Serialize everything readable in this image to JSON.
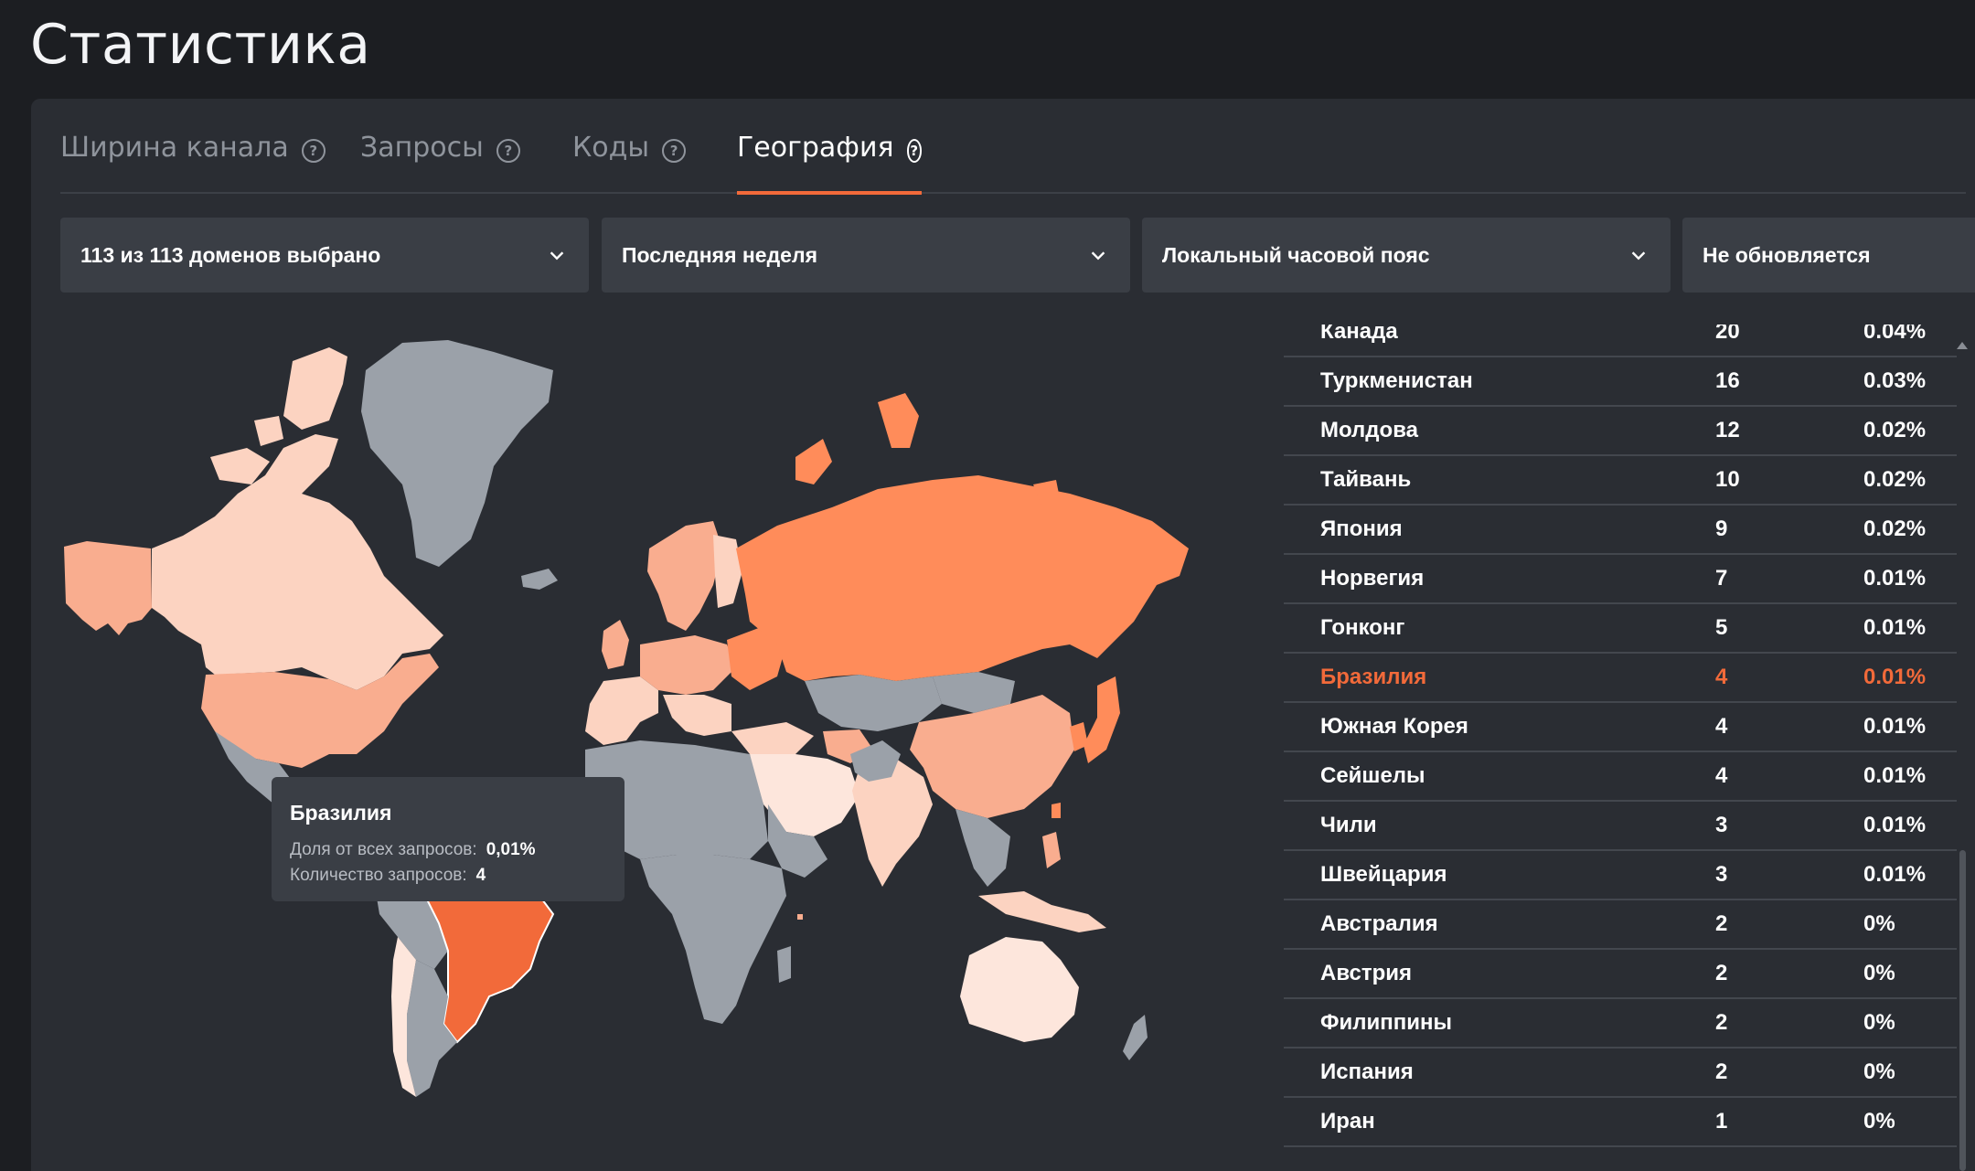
{
  "page_title": "Статистика",
  "tabs": [
    {
      "label": "Ширина канала",
      "active": false
    },
    {
      "label": "Запросы",
      "active": false
    },
    {
      "label": "Коды",
      "active": false
    },
    {
      "label": "География",
      "active": true
    }
  ],
  "filters": {
    "domains": "113 из 113 доменов выбрано",
    "period": "Последняя неделя",
    "timezone": "Локальный часовой пояс",
    "refresh": "Не обновляется"
  },
  "tooltip": {
    "country": "Бразилия",
    "share_label": "Доля от всех запросов:",
    "share_value": "0,01%",
    "count_label": "Количество запросов:",
    "count_value": "4"
  },
  "table": [
    {
      "country": "Канада",
      "count": "20",
      "percent": "0.04%"
    },
    {
      "country": "Туркменистан",
      "count": "16",
      "percent": "0.03%"
    },
    {
      "country": "Молдова",
      "count": "12",
      "percent": "0.02%"
    },
    {
      "country": "Тайвань",
      "count": "10",
      "percent": "0.02%"
    },
    {
      "country": "Япония",
      "count": "9",
      "percent": "0.02%"
    },
    {
      "country": "Норвегия",
      "count": "7",
      "percent": "0.01%"
    },
    {
      "country": "Гонконг",
      "count": "5",
      "percent": "0.01%"
    },
    {
      "country": "Бразилия",
      "count": "4",
      "percent": "0.01%",
      "highlighted": true
    },
    {
      "country": "Южная Корея",
      "count": "4",
      "percent": "0.01%"
    },
    {
      "country": "Сейшелы",
      "count": "4",
      "percent": "0.01%"
    },
    {
      "country": "Чили",
      "count": "3",
      "percent": "0.01%"
    },
    {
      "country": "Швейцария",
      "count": "3",
      "percent": "0.01%"
    },
    {
      "country": "Австралия",
      "count": "2",
      "percent": "0%"
    },
    {
      "country": "Австрия",
      "count": "2",
      "percent": "0%"
    },
    {
      "country": "Филиппины",
      "count": "2",
      "percent": "0%"
    },
    {
      "country": "Испания",
      "count": "2",
      "percent": "0%"
    },
    {
      "country": "Иран",
      "count": "1",
      "percent": "0%"
    }
  ],
  "colors": {
    "accent": "#f26a3a",
    "high": "#ff8c5a",
    "mid": "#f9ad8f",
    "low": "#fcd3c1",
    "lowest": "#fde6dc",
    "nodata": "#9ba1a9"
  }
}
